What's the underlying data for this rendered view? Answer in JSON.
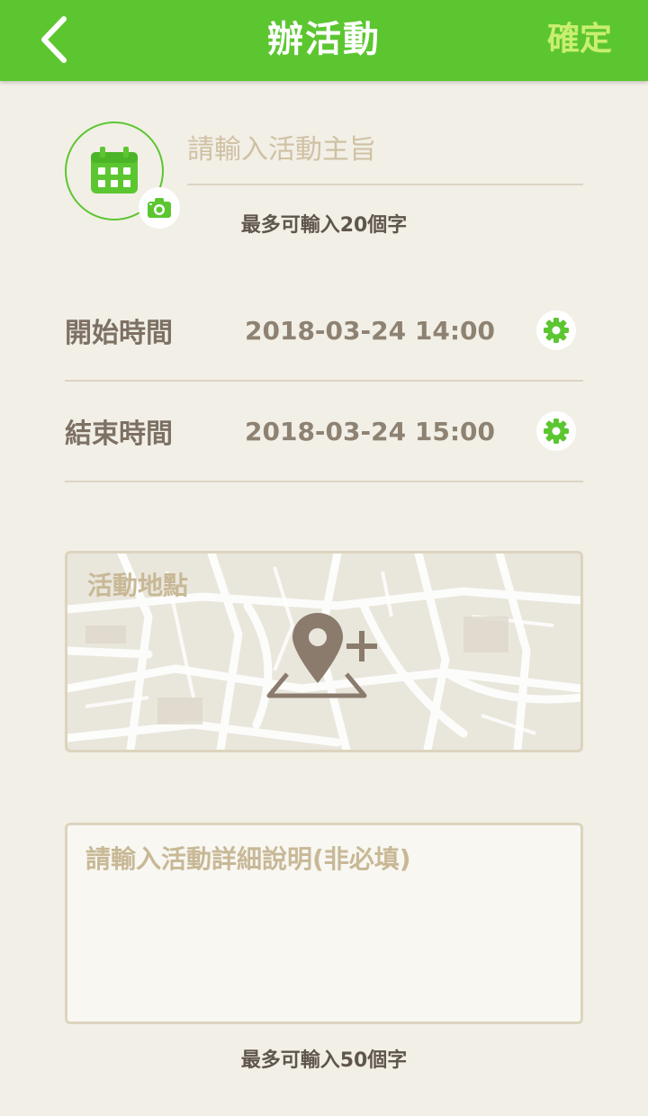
{
  "header": {
    "title": "辦活動",
    "confirm_label": "確定"
  },
  "form": {
    "title_placeholder": "請輸入活動主旨",
    "title_hint": "最多可輸入20個字",
    "start": {
      "label": "開始時間",
      "value": "2018-03-24 14:00"
    },
    "end": {
      "label": "結束時間",
      "value": "2018-03-24 15:00"
    },
    "location_label": "活動地點",
    "desc_placeholder": "請輸入活動詳細說明(非必填)",
    "desc_hint": "最多可輸入50個字"
  },
  "icons": {
    "back": "chevron-left-icon",
    "calendar": "calendar-icon",
    "camera": "camera-icon",
    "gear": "gear-icon",
    "add_location": "map-pin-add-icon"
  },
  "colors": {
    "accent": "#5cc631",
    "confirm": "#c9ef6e",
    "background": "#f2efe7",
    "label": "#7d7164",
    "placeholder": "#c8b896"
  }
}
